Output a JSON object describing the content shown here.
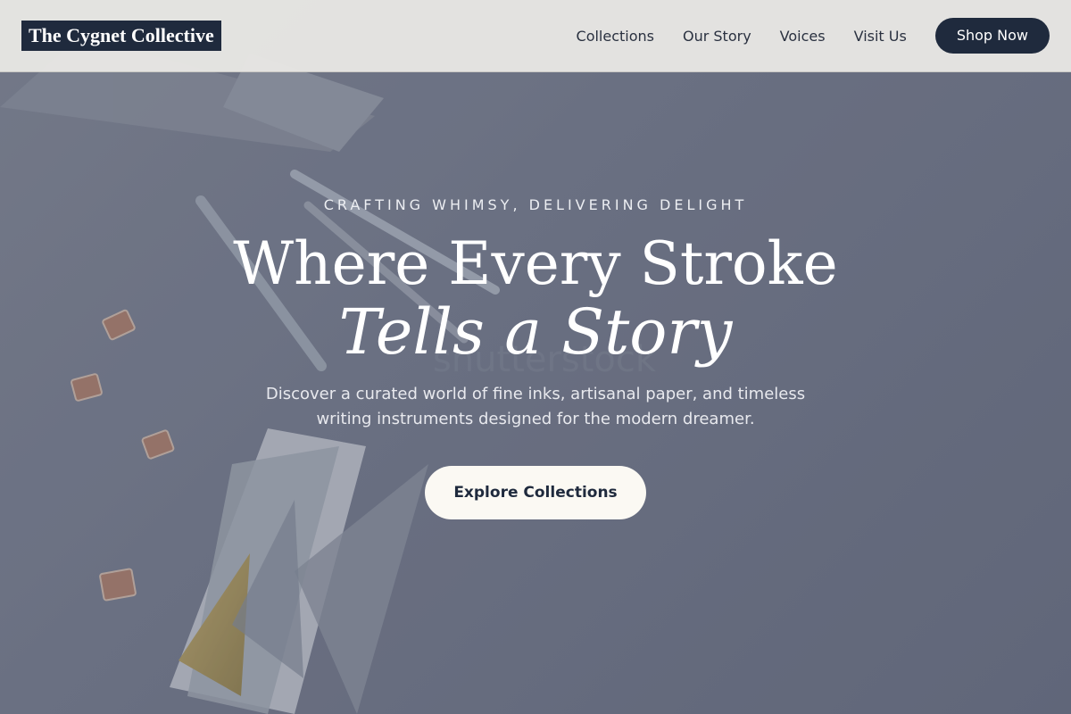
{
  "header": {
    "brand": "The Cygnet Collective",
    "nav": [
      "Collections",
      "Our Story",
      "Voices",
      "Visit Us"
    ],
    "cta": "Shop Now"
  },
  "hero": {
    "eyebrow": "CRAFTING WHIMSY, DELIVERING DELIGHT",
    "title_line1": "Where Every Stroke",
    "title_line2": "Tells a Story",
    "description": "Discover a curated world of fine inks, artisanal paper, and timeless writing instruments designed for the modern dreamer.",
    "button": "Explore Collections",
    "watermark": "shutterstock"
  },
  "colors": {
    "brand_bg": "#1f2a3d",
    "header_bg": "#e8e7e4",
    "cta_bg": "#fbf9f3",
    "hero_tint": "#6f7586"
  }
}
